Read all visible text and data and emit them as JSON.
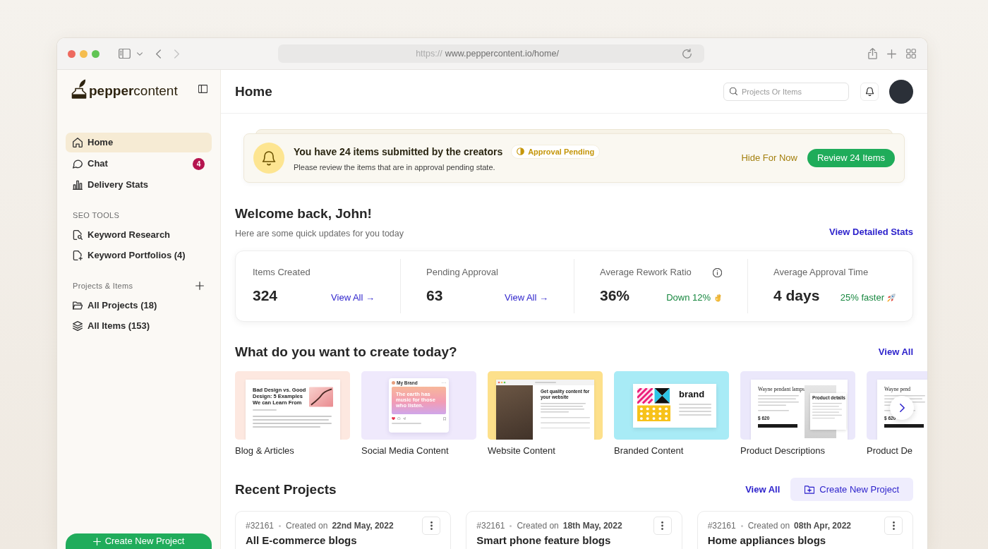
{
  "browser": {
    "url_scheme": "https://",
    "url_rest": "www.peppercontent.io/home/"
  },
  "sidebar": {
    "logo": "**pepper**content",
    "nav": [
      {
        "label": "Home",
        "selected": true
      },
      {
        "label": "Chat",
        "selected": false,
        "badge": "4"
      },
      {
        "label": "Delivery Stats",
        "selected": false
      }
    ],
    "sections": [
      {
        "title": "SEO TOOLS",
        "add": false,
        "items": [
          {
            "label": "Keyword Research",
            "selected": false
          },
          {
            "label": "Keyword Portfolios (4)",
            "selected": false
          }
        ]
      },
      {
        "title": "Projects & Items",
        "add": true,
        "items": [
          {
            "label": "All Projects (18)",
            "selected": false
          },
          {
            "label": "All Items (153)",
            "selected": false
          }
        ]
      }
    ],
    "create_button": "Create New Project"
  },
  "header": {
    "title": "Home",
    "search": {
      "placeholder": "Projects Or Items"
    }
  },
  "banner": {
    "title": "You have 24 items submitted by the creators",
    "status": "Approval Pending",
    "message": "Please review the items that are in approval pending state.",
    "secondary_action": "Hide For Now",
    "primary_action": "Review 24 Items"
  },
  "welcome": {
    "title": "Welcome back, John!",
    "subtitle": "Here are some quick updates for you today",
    "link": "View Detailed Stats"
  },
  "stats": [
    {
      "label": "Items Created",
      "value": "324",
      "link": "View All →",
      "info": false
    },
    {
      "label": "Pending Approval",
      "value": "63",
      "link": "View All →",
      "info": false
    },
    {
      "label": "Average Rework Ratio",
      "value": "36%",
      "change": "Down 12%",
      "info": true
    },
    {
      "label": "Average Approval Time",
      "value": "4 days",
      "change": "25% faster",
      "info": false
    }
  ],
  "create": {
    "title": "What do you want to create today?",
    "link": "View All",
    "cards": [
      {
        "label": "Blog & Articles",
        "kind": "blog",
        "headline": "Bad Design vs. Good Design: 5 Examples We can Learn From"
      },
      {
        "label": "Social Media Content",
        "kind": "social",
        "account": "My Brand",
        "headline": "The earth has music for those who listen."
      },
      {
        "label": "Website Content",
        "kind": "website",
        "headline": "Get quality content for your website"
      },
      {
        "label": "Branded Content",
        "kind": "branded",
        "headline": "brand"
      },
      {
        "label": "Product Descriptions",
        "kind": "product",
        "headline": "Wayne pendant lamps",
        "details_title": "Product details",
        "price": "$ 620"
      },
      {
        "label": "Product De",
        "kind": "product",
        "headline": "Wayne pend",
        "price": "$ 620"
      }
    ]
  },
  "recent_projects": {
    "title": "Recent Projects",
    "link": "View All",
    "button": "Create New Project",
    "projects": [
      {
        "id": "#32161",
        "created_label": "Created on",
        "date": "22nd May, 2022",
        "title": "All E-commerce blogs"
      },
      {
        "id": "#32161",
        "created_label": "Created on",
        "date": "18th May, 2022",
        "title": "Smart phone feature blogs"
      },
      {
        "id": "#32161",
        "created_label": "Created on",
        "date": "08th Apr, 2022",
        "title": "Home appliances blogs"
      }
    ]
  }
}
